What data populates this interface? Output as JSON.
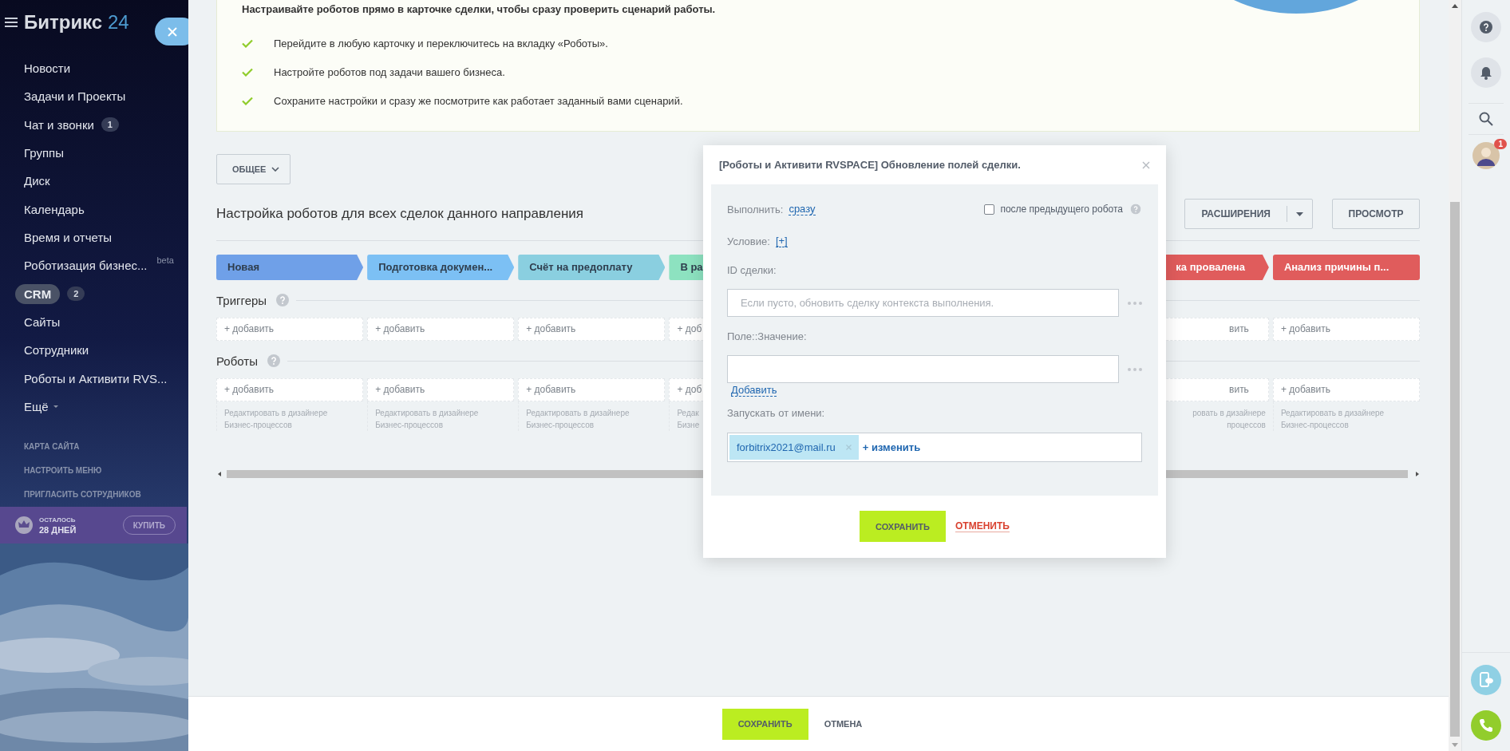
{
  "sidebar": {
    "logo": "Битрикс",
    "logo_number": "24",
    "items": [
      {
        "label": "Новости",
        "selected": false
      },
      {
        "label": "Задачи и Проекты",
        "selected": false
      },
      {
        "label": "Чат и звонки",
        "badge": "1",
        "selected": false
      },
      {
        "label": "Группы",
        "selected": false
      },
      {
        "label": "Диск",
        "selected": false
      },
      {
        "label": "Календарь",
        "selected": false
      },
      {
        "label": "Время и отчеты",
        "selected": false
      },
      {
        "label": "Роботизация бизнес...",
        "tag": "beta",
        "selected": false
      },
      {
        "label": "CRM",
        "badge": "2",
        "selected": true
      },
      {
        "label": "Сайты",
        "selected": false
      },
      {
        "label": "Сотрудники",
        "selected": false
      },
      {
        "label": "Роботы и Активити RVS...",
        "selected": false
      },
      {
        "label": "Ещё",
        "kind": "more",
        "selected": false
      }
    ],
    "links": [
      "КАРТА САЙТА",
      "НАСТРОИТЬ МЕНЮ",
      "ПРИГЛАСИТЬ СОТРУДНИКОВ"
    ],
    "trial": {
      "label": "ОСТАЛОСЬ",
      "days": "28 ДНЕЙ",
      "button": "КУПИТЬ"
    }
  },
  "intro": {
    "title": "Настраивайте роботов прямо в карточке сделки, чтобы сразу проверить сценарий работы.",
    "steps": [
      "Перейдите в любую карточку и переключитесь на вкладку «Роботы».",
      "Настройте роботов под задачи вашего бизнеса.",
      "Сохраните настройки и сразу же посмотрите как работает заданный вами сценарий."
    ]
  },
  "filter_button": "ОБЩЕЕ",
  "heading": "Настройка роботов для всех сделок данного направления",
  "buttons": [
    {
      "label": "РАСШИРЕНИЯ",
      "kind": "split"
    },
    {
      "label": "ПРОСМОТР",
      "kind": "plain"
    }
  ],
  "stages": [
    {
      "label": "Новая",
      "color": "#6fa0e8",
      "kind": "whole"
    },
    {
      "label": "Подготовка докумен...",
      "color": "#7cc0f4",
      "kind": "whole"
    },
    {
      "label": "Счёт на предоплату",
      "color": "#8acfe0",
      "kind": "whole"
    },
    {
      "label": "В ра",
      "color": "#8de2c0",
      "kind": "whole"
    },
    {
      "label": "ка провалена",
      "color": "#e05c5c",
      "kind": "tail"
    },
    {
      "label": "Анализ причины п...",
      "color": "#e05c5c",
      "kind": "whole"
    }
  ],
  "triggers": {
    "title": "Триггеры",
    "cells": [
      "+ добавить",
      "+ добавить",
      "+ добавить",
      "+ доб",
      "вить",
      "+ добавить"
    ]
  },
  "robots": {
    "title": "Роботы",
    "cells": [
      {
        "add": "+ добавить",
        "hint": [
          "Редактировать в дизайнере",
          "Бизнес-процессов"
        ]
      },
      {
        "add": "+ добавить",
        "hint": [
          "Редактировать в дизайнере",
          "Бизнес-процессов"
        ]
      },
      {
        "add": "+ добавить",
        "hint": [
          "Редактировать в дизайнере",
          "Бизнес-процессов"
        ]
      },
      {
        "add": "+ доб",
        "hint": [
          "Редак",
          "Бизне"
        ]
      },
      {
        "add": "вить",
        "hint": [
          "ровать в дизайнере",
          "процессов"
        ]
      },
      {
        "add": "+ добавить",
        "hint": [
          "Редактировать в дизайнере",
          "Бизнес-процессов"
        ]
      }
    ]
  },
  "dialog": {
    "title": "[Роботы и Активити RVSPACE] Обновление полей сделки.",
    "run_label": "Выполнить:",
    "run_value": "сразу",
    "after_previous": {
      "label": "после предыдущего робота",
      "checked": false
    },
    "condition_label": "Условие:",
    "condition_value": "[+]",
    "deal_id": {
      "label": "ID сделки:",
      "placeholder": "Если пусто, обновить сделку контекста выполнения."
    },
    "field_value": {
      "label": "Поле::Значение:"
    },
    "add_link": "Добавить",
    "run_as": {
      "label": "Запускать от имени:",
      "user": "forbitrix2021@mail.ru",
      "change": "+ изменить"
    },
    "save": "СОХРАНИТЬ",
    "cancel": "ОТМЕНИТЬ"
  },
  "footer": {
    "save": "СОХРАНИТЬ",
    "cancel": "ОТМЕНА"
  },
  "rightbar": {
    "avatar_badge": "1"
  }
}
